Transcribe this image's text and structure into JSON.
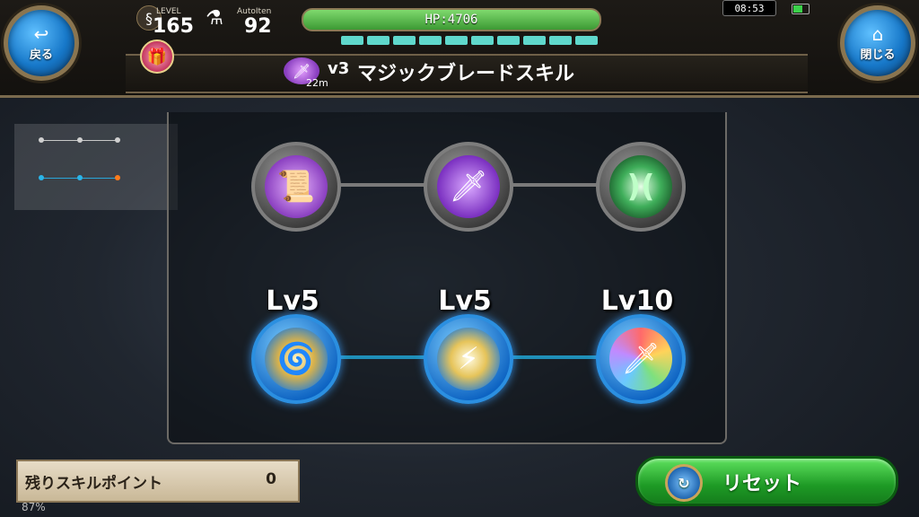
{
  "header": {
    "back_label": "戻る",
    "close_label": "閉じる",
    "level_caption": "LEVEL",
    "level_value": "165",
    "autoitem_caption": "AutoIten",
    "autoitem_value": "92",
    "hp_text": "HP:4706",
    "mp_segments": 10,
    "clock": "08:53",
    "title_prefix": "v3",
    "title": "マジックブレードスキル",
    "distance": "22m"
  },
  "legend": {
    "rows": [
      {
        "color": "#c8c8c8",
        "dots": [
          "#d0d0d0",
          "#d0d0d0",
          "#d0d0d0"
        ]
      },
      {
        "color": "#29a6d9",
        "dots": [
          "#2ab4e8",
          "#2ab4e8",
          "#ff7a1a"
        ]
      }
    ]
  },
  "skills": {
    "row1": [
      {
        "name": "scroll-ring-skill",
        "icon": "📜",
        "state": "locked"
      },
      {
        "name": "magic-sword-skill",
        "icon": "🗡",
        "state": "locked"
      },
      {
        "name": "green-wave-skill",
        "icon": ")(",
        "state": "locked"
      }
    ],
    "row2": [
      {
        "name": "wind-swirl-skill",
        "icon": "🌀",
        "state": "learned",
        "level": "Lv5"
      },
      {
        "name": "light-slash-skill",
        "icon": "⚡",
        "state": "learned",
        "level": "Lv5"
      },
      {
        "name": "rainbow-sword-skill",
        "icon": "🗡",
        "state": "learned",
        "level": "Lv10"
      }
    ]
  },
  "footer": {
    "points_label": "残りスキルポイント",
    "points_value": "0",
    "reset_label": "リセット",
    "percent": "87%"
  },
  "colors": {
    "reset_green": "#1e9a25",
    "hp_green": "#3c9a34",
    "mp_cyan": "#5fd8cc",
    "node_blue": "#0d63c2"
  }
}
